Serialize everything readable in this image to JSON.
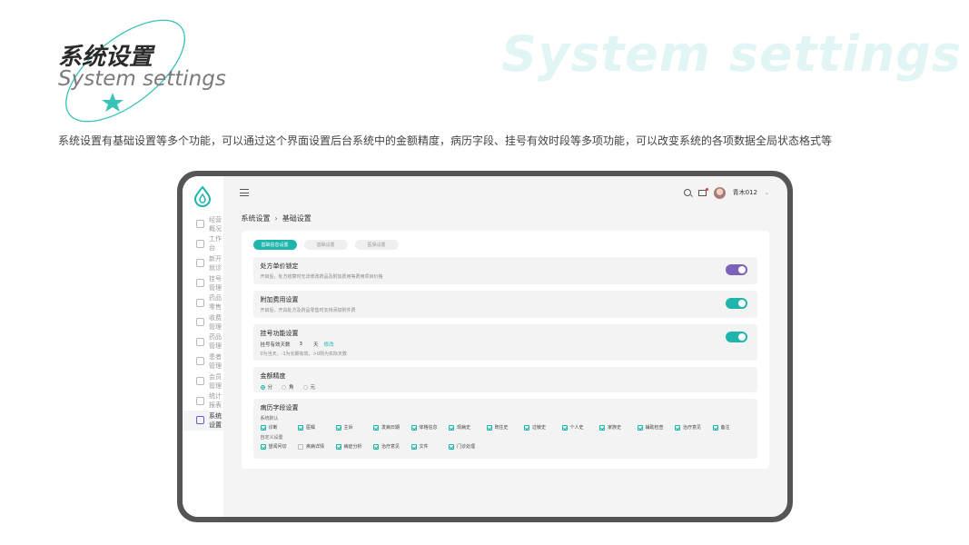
{
  "hero": {
    "title": "系统设置",
    "subtitle": "System settings",
    "bg_text": "System settings",
    "description": "系统设置有基础设置等多个功能，可以通过这个界面设置后台系统中的金额精度，病历字段、挂号有效时段等多项功能，可以改变系统的各项数据全局状态格式等"
  },
  "colors": {
    "accent": "#1eb5ad",
    "purple": "#7c62b8"
  },
  "sidebar": {
    "items": [
      {
        "label": "经营概况",
        "icon": "chart-icon",
        "active": false
      },
      {
        "label": "工作台",
        "icon": "monitor-icon",
        "active": false
      },
      {
        "label": "新开就诊",
        "icon": "folder-icon",
        "active": false
      },
      {
        "label": "挂号管理",
        "icon": "register-icon",
        "active": false
      },
      {
        "label": "药品零售",
        "icon": "pill-grid-icon",
        "active": false
      },
      {
        "label": "收费管理",
        "icon": "fee-icon",
        "active": false
      },
      {
        "label": "药品管理",
        "icon": "capsule-icon",
        "active": false
      },
      {
        "label": "患者管理",
        "icon": "user-icon",
        "active": false
      },
      {
        "label": "会员管理",
        "icon": "basket-icon",
        "active": false
      },
      {
        "label": "统计报表",
        "icon": "report-icon",
        "active": false
      },
      {
        "label": "系统设置",
        "icon": "settings-icon",
        "active": true
      }
    ]
  },
  "topbar": {
    "user_name": "青木012"
  },
  "breadcrumb": {
    "root": "系统设置",
    "current": "基础设置"
  },
  "tabs": [
    {
      "label": "基础信息设置",
      "active": true
    },
    {
      "label": "基础设置",
      "active": false
    },
    {
      "label": "医保设置",
      "active": false
    }
  ],
  "panels": {
    "price_lock": {
      "title": "处方单价锁定",
      "desc": "开启后，处方结算时无法修改药品及附加费用等费用项目价格"
    },
    "extra_fee": {
      "title": "附加费用设置",
      "desc": "开启后，开具处方及药品零售时支持添加附件费"
    },
    "register": {
      "title": "挂号功能设置",
      "days_label": "挂号有效天数",
      "days_value": "3",
      "days_unit": "天",
      "edit_label": "修改",
      "desc": "0为当天，-1为长期有效，>0则为实际天数"
    },
    "precision": {
      "title": "金额精度",
      "options": [
        {
          "label": "分",
          "selected": true
        },
        {
          "label": "角",
          "selected": false
        },
        {
          "label": "元",
          "selected": false
        }
      ]
    },
    "fields": {
      "title": "病历字段设置",
      "default_label": "系统默认",
      "default_items": [
        "诊断",
        "医嘱",
        "主诉",
        "发病日期",
        "体格信息",
        "现病史",
        "既往史",
        "过敏史",
        "个人史",
        "家族史",
        "辅助检查",
        "治疗意见",
        "备注"
      ],
      "custom_label": "自定义设置",
      "custom_items": [
        {
          "label": "望闻问切",
          "checked": true
        },
        {
          "label": "疾病详情",
          "checked": false
        },
        {
          "label": "病症分析",
          "checked": true
        },
        {
          "label": "治疗意见",
          "checked": true
        },
        {
          "label": "文件",
          "checked": true
        },
        {
          "label": "门诊处理",
          "checked": true
        }
      ]
    }
  }
}
